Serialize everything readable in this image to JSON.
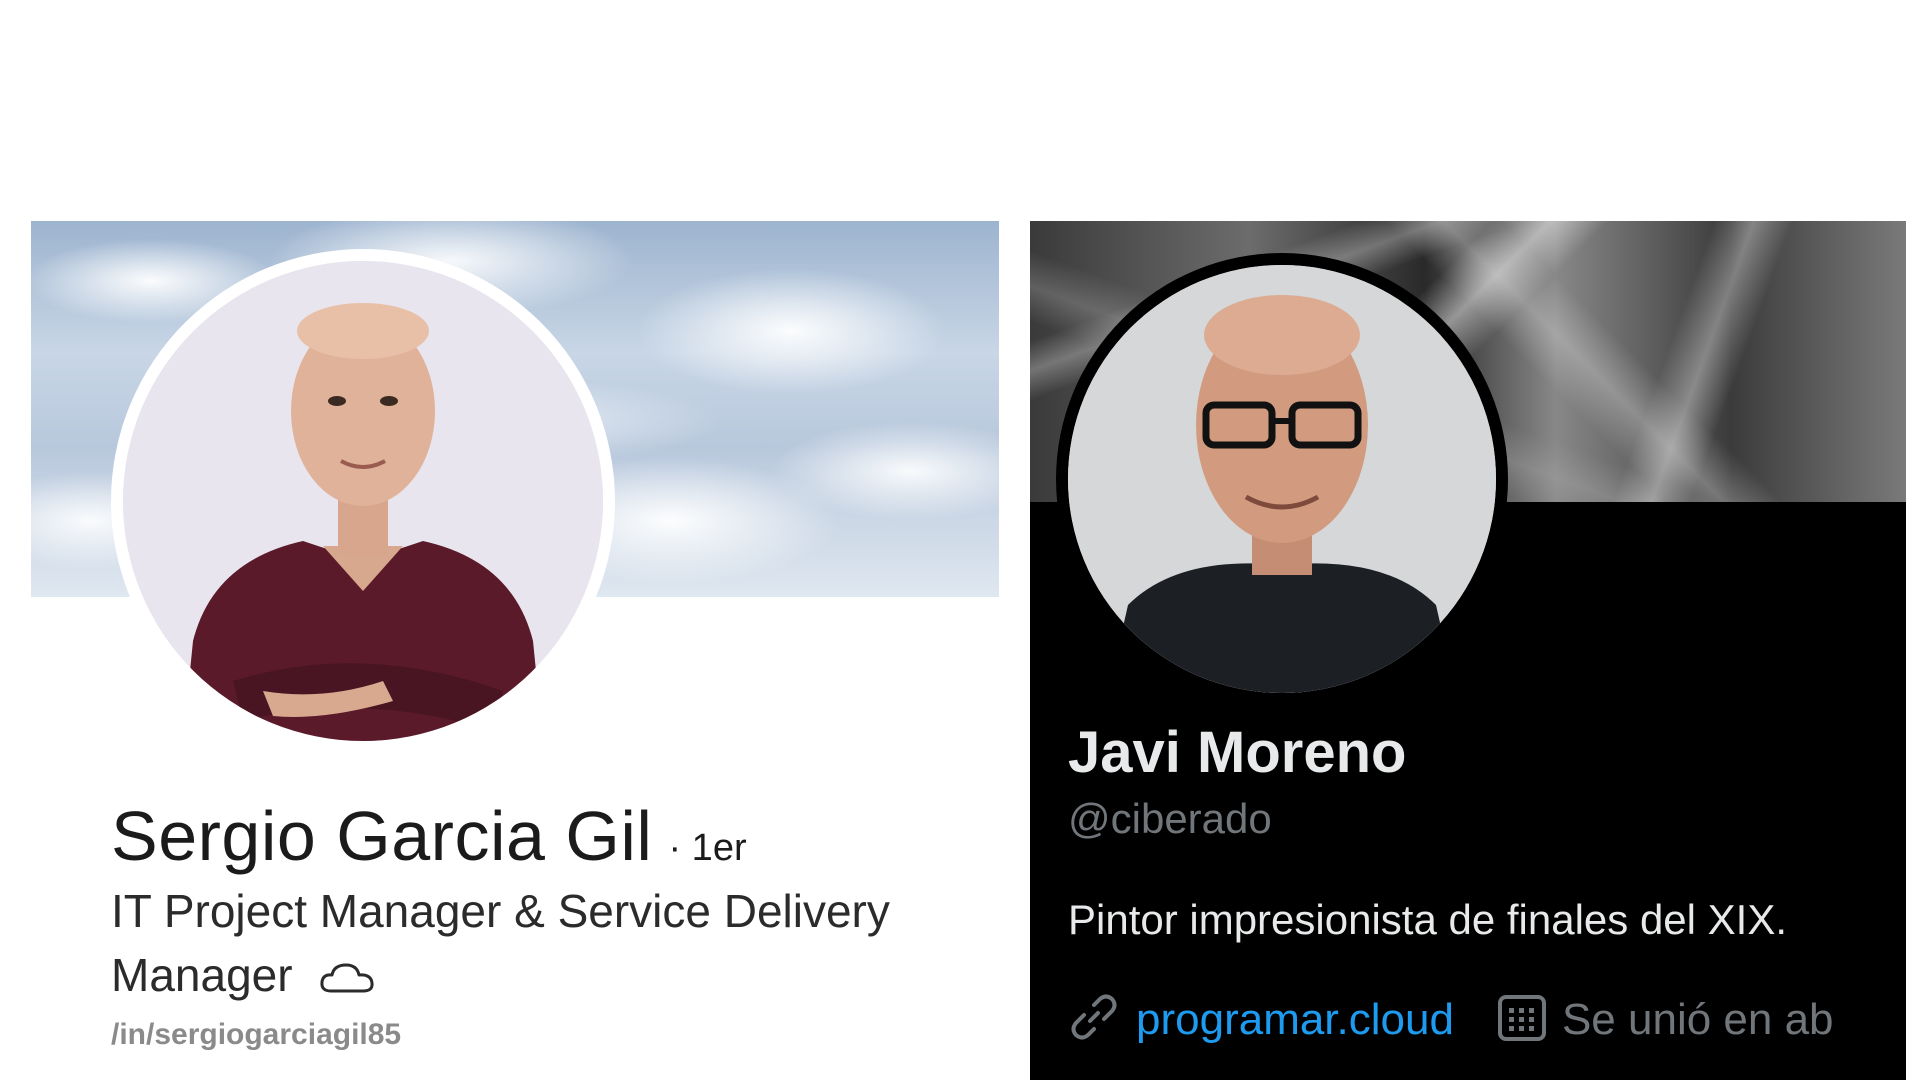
{
  "linkedin": {
    "name": "Sergio Garcia Gil",
    "degree": "· 1er",
    "headline": "IT Project Manager & Service Delivery Manager",
    "url": "/in/sergiogarciagil85",
    "headline_icon": "cloud-icon"
  },
  "twitter": {
    "name": "Javi Moreno",
    "handle": "@ciberado",
    "bio": "Pintor impresionista de finales del XIX.",
    "link": "programar.cloud",
    "joined": "Se unió en ab",
    "link_icon": "link-icon",
    "calendar_icon": "calendar-icon",
    "colors": {
      "link": "#1d9bf0",
      "muted": "#71767b",
      "text": "#e7e9ea",
      "background": "#000000"
    }
  }
}
